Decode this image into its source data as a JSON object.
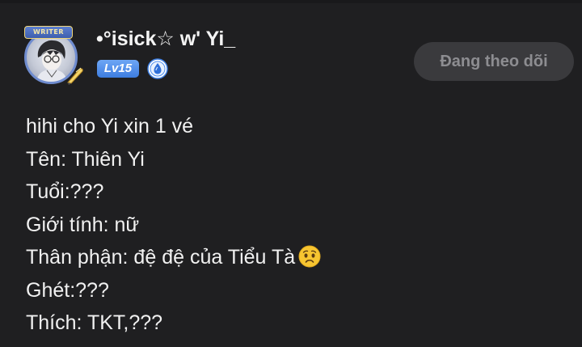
{
  "post": {
    "author": {
      "username": "•°isick☆ w' Yi_",
      "avatar_frame_label": "WRITER",
      "level": "Lv15",
      "verified_icon": "water-drop-badge-icon"
    },
    "follow_button_label": "Đang theo dõi",
    "lines": [
      "hihi cho Yi xin 1 vé",
      "Tên: Thiên Yi",
      "Tuổi:???",
      "Giới tính: nữ",
      "Thân phận: đệ đệ của Tiểu Tà",
      "Ghét:???",
      "Thích: TKT,???"
    ],
    "emoji_after_line_5": "worried-face-emoji"
  },
  "colors": {
    "background": "#1f1f21",
    "level_badge": "#4f8ff0",
    "follow_button_bg": "#3a3a3d",
    "follow_button_text": "#8d8d91"
  }
}
